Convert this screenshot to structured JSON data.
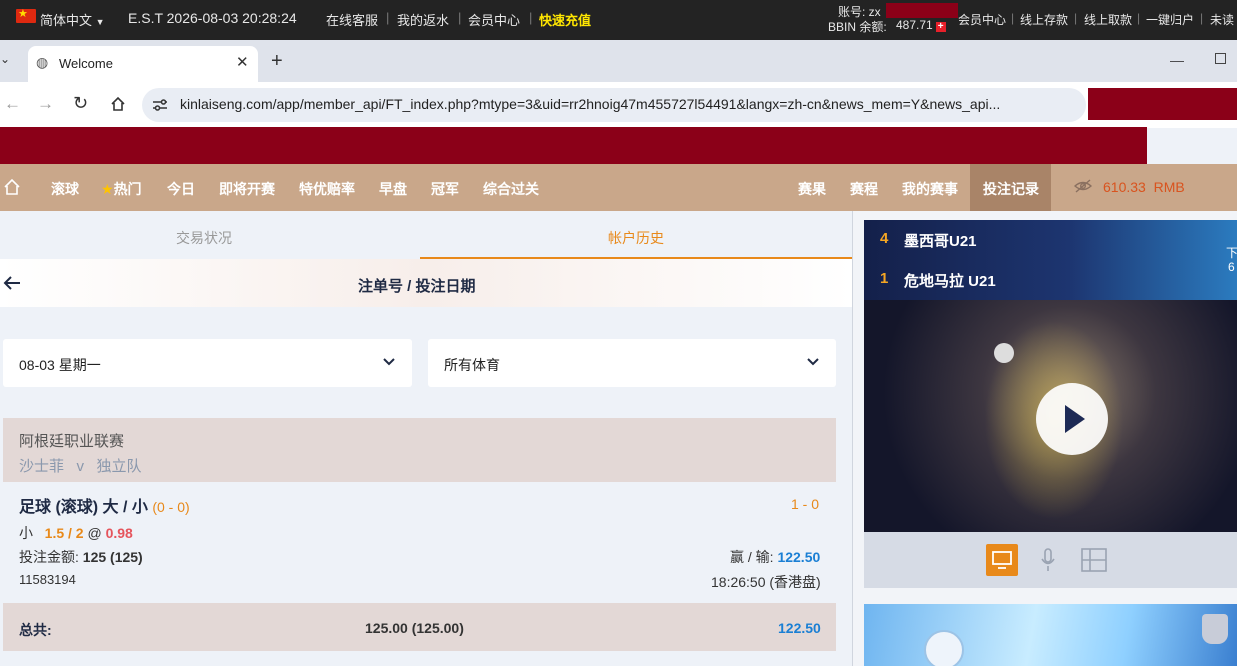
{
  "topbar": {
    "language": "简体中文",
    "clock": "E.S.T 2026-08-03 20:28:24",
    "links": [
      "在线客服",
      "我的返水",
      "会员中心"
    ],
    "recharge": "快速充值",
    "account_label": "账号: zx",
    "balance_label": "BBIN 余额:",
    "balance_value": "487.71",
    "right_links": [
      "会员中心",
      "线上存款",
      "线上取款",
      "一键归户",
      "未读"
    ]
  },
  "browser": {
    "tab_title": "Welcome",
    "url": "kinlaiseng.com/app/member_api/FT_index.php?mtype=3&uid=rr2hnoig47m455727l54491&langx=zh-cn&news_mem=Y&news_api..."
  },
  "nav": {
    "items": [
      "滚球",
      "热门",
      "今日",
      "即将开赛",
      "特优赔率",
      "早盘",
      "冠军",
      "综合过关"
    ],
    "right_items": [
      "赛果",
      "赛程",
      "我的赛事",
      "投注记录"
    ],
    "balance": "610.33",
    "currency": "RMB"
  },
  "subtabs": [
    "交易状况",
    "帐户历史"
  ],
  "history": {
    "title": "注单号 / 投注日期",
    "date_select": "08-03 星期一",
    "sport_select": "所有体育"
  },
  "bet": {
    "league": "阿根廷职业联赛",
    "home": "沙士菲",
    "vs": "v",
    "away": "独立队",
    "market": "足球 (滚球) 大 / 小",
    "score_at_bet": "(0 - 0)",
    "final_score": "1 - 0",
    "selection": "小",
    "line": "1.5 / 2",
    "at": "@",
    "odds": "0.98",
    "stake_label": "投注金额:",
    "stake_value": "125 (125)",
    "winloss_label": "赢 / 输:",
    "winloss_value": "122.50",
    "ticket_id": "11583194",
    "time": "18:26:50 (香港盘)"
  },
  "total": {
    "label": "总共:",
    "stake": "125.00 (125.00)",
    "winloss": "122.50"
  },
  "live": {
    "home_score": "4",
    "home_team": "墨西哥U21",
    "away_score": "1",
    "away_team": "危地马拉 U21",
    "edge_text_1": "下",
    "edge_text_2": "6"
  },
  "colors": {
    "nav_bg": "#c9a78a",
    "accent_orange": "#e8891a",
    "link_blue": "#1a7fd4",
    "banner_red": "#8b0018"
  }
}
